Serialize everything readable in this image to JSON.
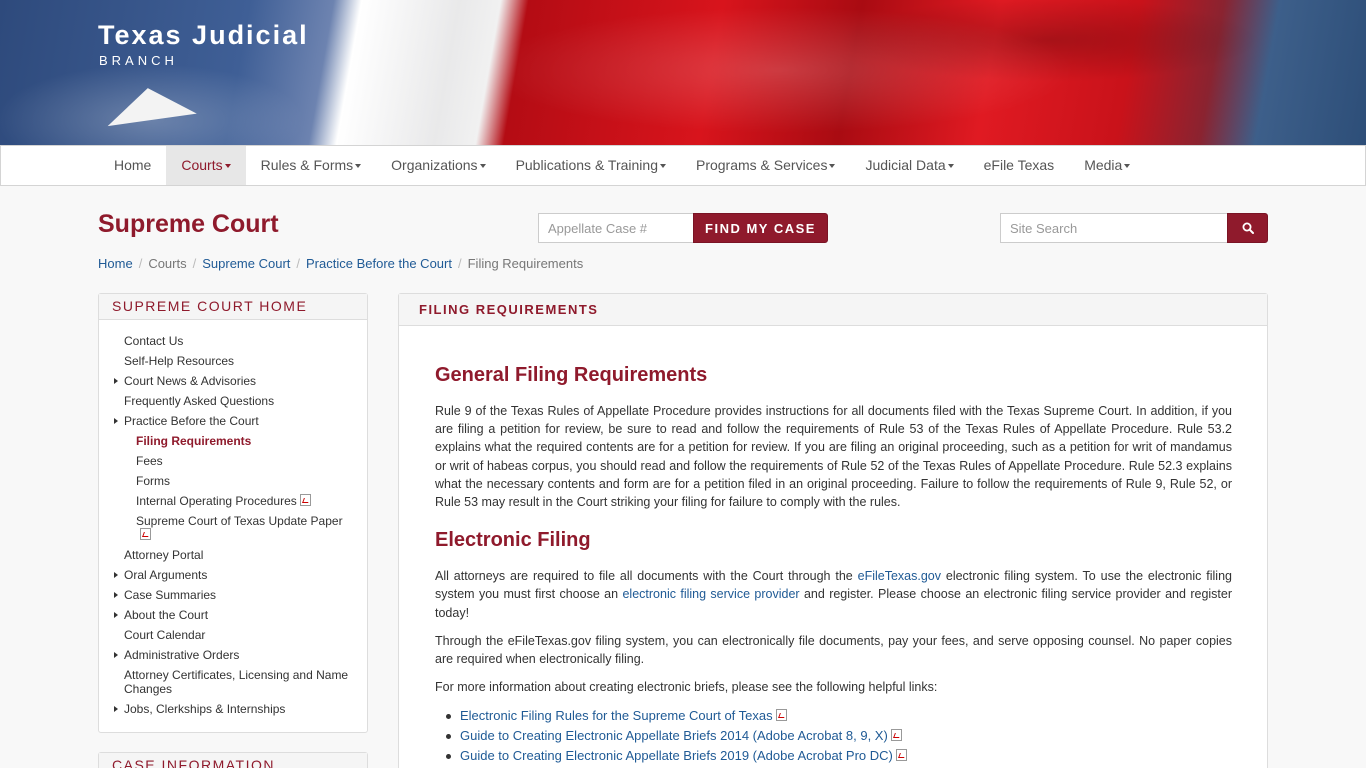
{
  "brand": {
    "title": "Texas Judicial",
    "subtitle": "BRANCH"
  },
  "nav": {
    "items": [
      {
        "label": "Home",
        "dropdown": false
      },
      {
        "label": "Courts",
        "dropdown": true,
        "active": true
      },
      {
        "label": "Rules & Forms",
        "dropdown": true
      },
      {
        "label": "Organizations",
        "dropdown": true
      },
      {
        "label": "Publications & Training",
        "dropdown": true
      },
      {
        "label": "Programs & Services",
        "dropdown": true
      },
      {
        "label": "Judicial Data",
        "dropdown": true
      },
      {
        "label": "eFile Texas",
        "dropdown": false
      },
      {
        "label": "Media",
        "dropdown": true
      }
    ]
  },
  "page": {
    "title": "Supreme Court"
  },
  "case_search": {
    "placeholder": "Appellate Case #",
    "button": "FIND MY CASE"
  },
  "site_search": {
    "placeholder": "Site Search",
    "icon": "search-icon"
  },
  "breadcrumb": {
    "home": "Home",
    "courts": "Courts",
    "supreme": "Supreme Court",
    "practice": "Practice Before the Court",
    "current": "Filing Requirements"
  },
  "sidebar": {
    "heading": "SUPREME COURT HOME",
    "items": {
      "contact": "Contact Us",
      "selfhelp": "Self-Help Resources",
      "news": "Court News & Advisories",
      "faq": "Frequently Asked Questions",
      "practice": "Practice Before the Court",
      "filing": "Filing Requirements",
      "fees": "Fees",
      "forms": "Forms",
      "iop": "Internal Operating Procedures",
      "update": "Supreme Court of Texas Update Paper",
      "portal": "Attorney Portal",
      "oral": "Oral Arguments",
      "summaries": "Case Summaries",
      "about": "About the Court",
      "calendar": "Court Calendar",
      "admin": "Administrative Orders",
      "certs": "Attorney Certificates, Licensing and Name Changes",
      "jobs": "Jobs, Clerkships & Internships"
    },
    "second_heading": "CASE INFORMATION"
  },
  "main": {
    "heading": "FILING REQUIREMENTS",
    "h_general": "General Filing Requirements",
    "p_general": "Rule 9 of the Texas Rules of Appellate Procedure provides instructions for all documents filed with the Texas Supreme Court. In addition, if you are filing a petition for review, be sure to read and follow the requirements of Rule 53 of the Texas Rules of Appellate Procedure. Rule 53.2 explains what the required contents are for a petition for review. If you are filing an original proceeding, such as a petition for writ of mandamus or writ of habeas corpus, you should read and follow the requirements of Rule 52 of the Texas Rules of Appellate Procedure. Rule 52.3 explains what the necessary contents and form are for a petition filed in an original proceeding. Failure to follow the requirements of Rule 9, Rule 52, or Rule 53 may result in the Court striking your filing for failure to comply with the rules.",
    "h_electronic": "Electronic Filing",
    "p1_a": "All attorneys are required to file all documents with the Court through the ",
    "p1_link1": "eFileTexas.gov",
    "p1_b": " electronic filing system. To use the electronic filing system you must first choose an ",
    "p1_link2": "electronic filing service provider",
    "p1_c": " and register. Please choose an electronic filing service provider and register today!",
    "p2": "Through the eFileTexas.gov filing system, you can electronically file documents, pay your fees, and serve opposing counsel. No paper copies are required when electronically filing.",
    "p3": "For more information about creating electronic briefs, please see the following helpful links:",
    "links": [
      "Electronic Filing Rules for the Supreme Court of Texas",
      "Guide to Creating Electronic Appellate Briefs 2014 (Adobe Acrobat 8, 9, X)",
      "Guide to Creating Electronic Appellate Briefs 2019 (Adobe Acrobat Pro DC)"
    ]
  },
  "colors": {
    "accent": "#8f1a2c",
    "link": "#1f5a95"
  }
}
